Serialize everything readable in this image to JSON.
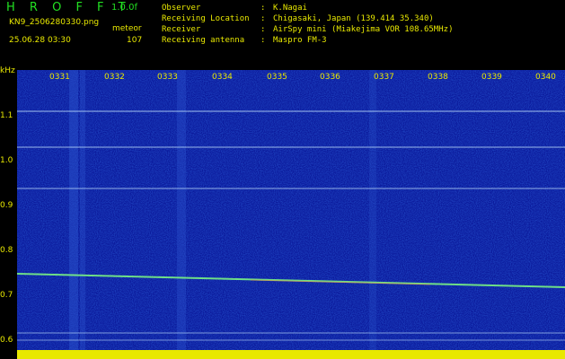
{
  "app": {
    "name": "H R O F F T",
    "version": "1.0.0f"
  },
  "file": {
    "name": "KN9_2506280330.png",
    "datetime": "25.06.28 03:30",
    "mode": "meteor",
    "count": "107"
  },
  "meta": [
    {
      "key": "Observer",
      "value": "K.Nagai"
    },
    {
      "key": "Receiving Location",
      "value": "Chigasaki, Japan (139.414 35.340)"
    },
    {
      "key": "Receiver",
      "value": "AirSpy mini (Miakejima VOR 108.65MHz)"
    },
    {
      "key": "Receiving antenna",
      "value": "Maspro FM-3"
    }
  ],
  "axis": {
    "unit": "kHz",
    "yticks": [
      "1.1",
      "1.0",
      "0.9",
      "0.8",
      "0.7",
      "0.6"
    ],
    "xticks": [
      "0331",
      "0332",
      "0333",
      "0334",
      "0335",
      "0336",
      "0337",
      "0338",
      "0339",
      "0340"
    ]
  },
  "colors": {
    "background": "#0b1a9c",
    "text": "#e8e800",
    "brand": "#22e022"
  }
}
